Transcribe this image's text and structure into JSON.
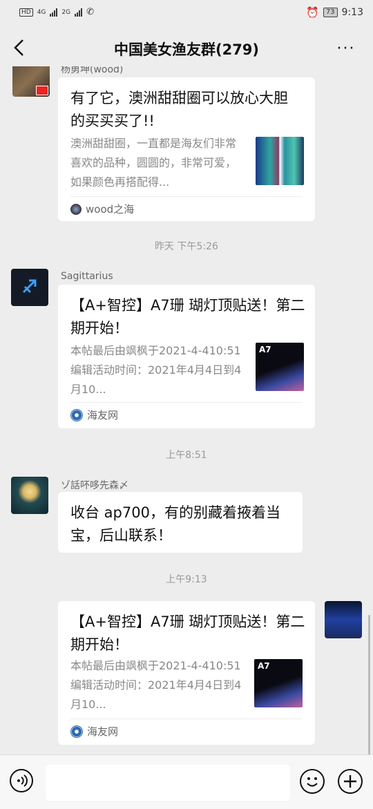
{
  "status_bar": {
    "network_hd": "HD",
    "network_1": "4G",
    "network_2": "2G",
    "battery": "73",
    "time": "9:13"
  },
  "header": {
    "title": "中国美女渔友群(279)",
    "more": "···"
  },
  "messages": [
    {
      "sender": "杨勇坤(wood)",
      "title": "有了它，澳洲甜甜圈可以放心大胆的买买买了!!",
      "desc": "澳洲甜甜圈，一直都是海友们非常喜欢的品种，圆圆的，非常可爱，如果颜色再搭配得...",
      "source": "wood之海"
    },
    {
      "timestamp": "昨天 下午5:26"
    },
    {
      "sender": "Sagittarius",
      "title": "【A+智控】A7珊 瑚灯顶贴送！第二期开始！",
      "desc": "本帖最后由飒枫于2021-4-410:51编辑活动时间：2021年4月4日到4月10...",
      "source": "海友网",
      "thumb_label": "A7"
    },
    {
      "timestamp": "上午8:51"
    },
    {
      "sender": "ゾ話吥哆先森〆",
      "text": "收台 ap700，有的别藏着掖着当宝，后山联系！"
    },
    {
      "timestamp": "上午9:13"
    },
    {
      "title": "【A+智控】A7珊 瑚灯顶贴送！第二期开始！",
      "desc": "本帖最后由飒枫于2021-4-410:51编辑活动时间：2021年4月4日到4月10...",
      "source": "海友网",
      "thumb_label": "A7"
    }
  ],
  "input_bar": {
    "placeholder": ""
  },
  "colors": {
    "background": "#ededed",
    "bubble": "#ffffff",
    "muted_text": "#888888"
  }
}
